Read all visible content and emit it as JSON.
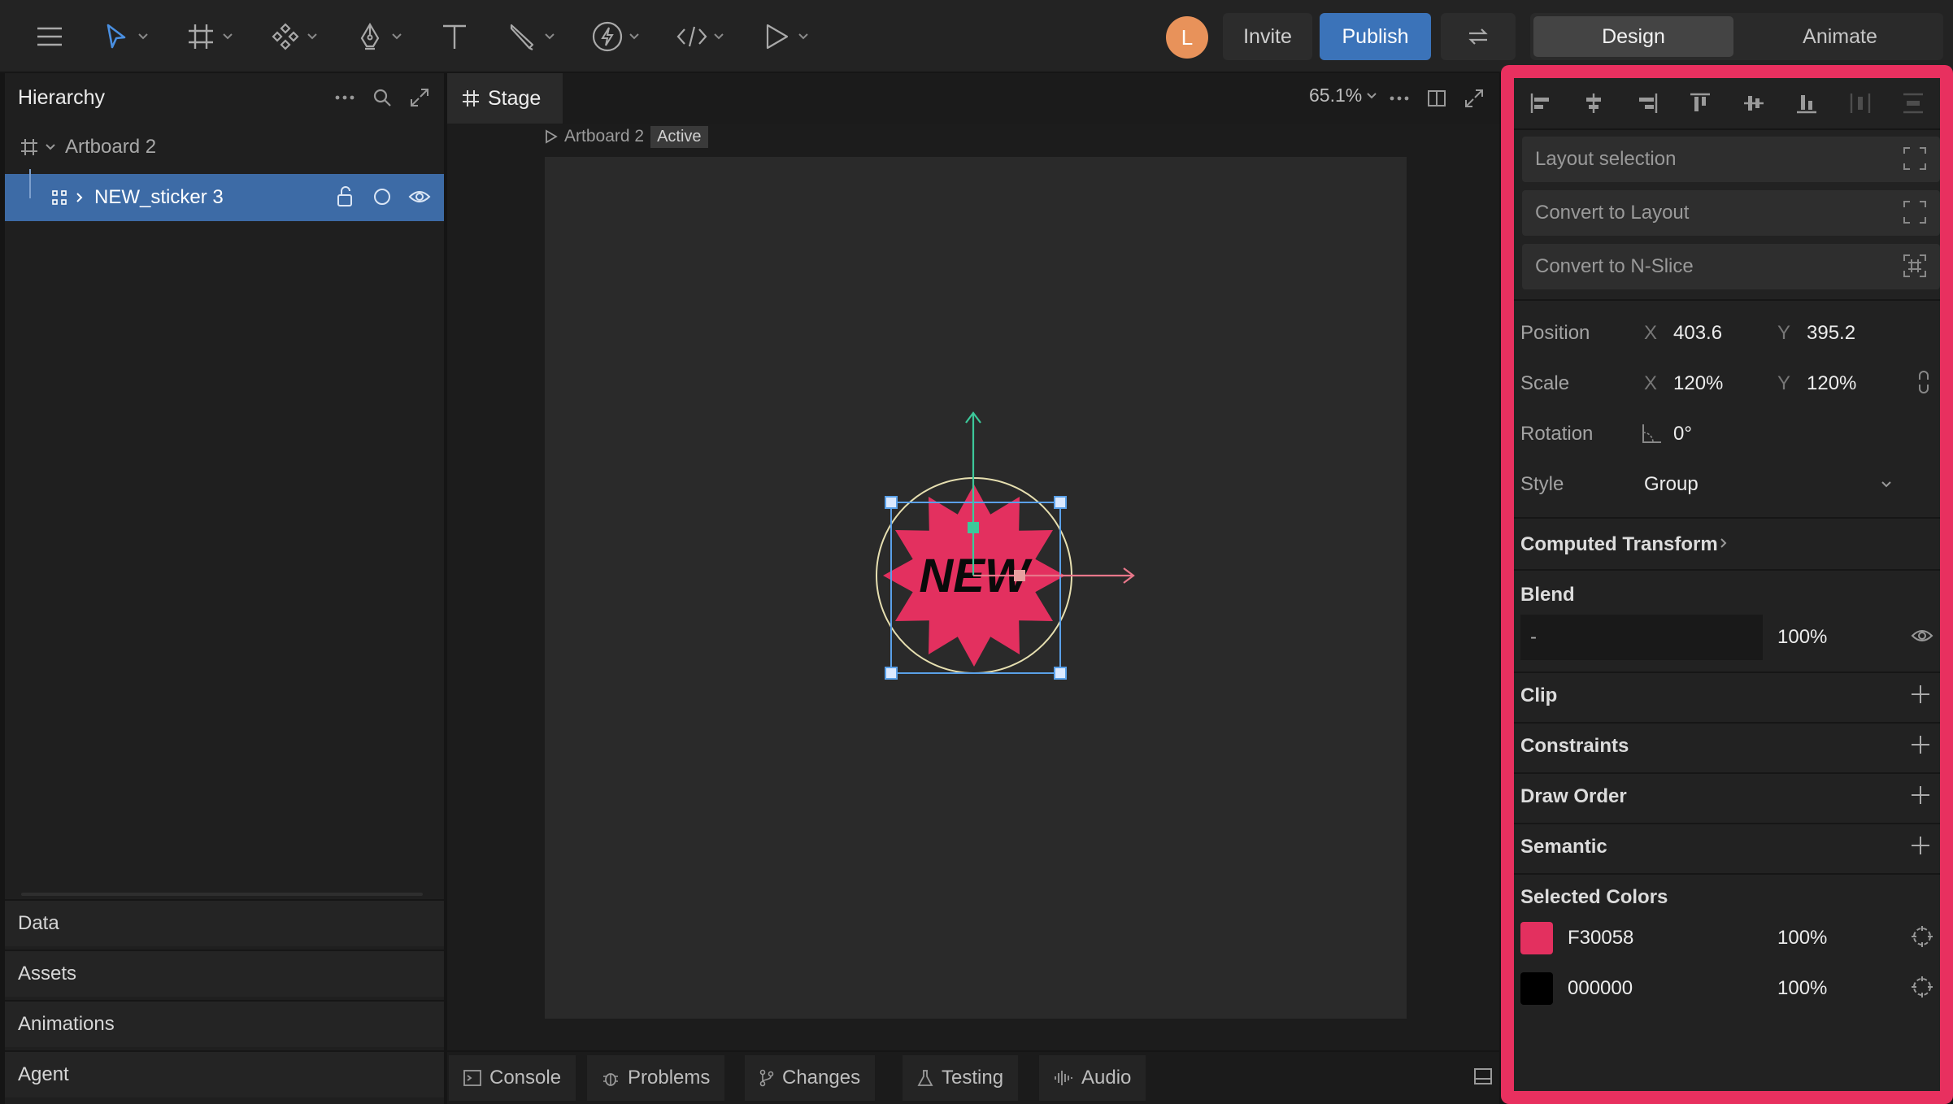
{
  "toolbar": {
    "avatar_initial": "L",
    "invite_label": "Invite",
    "publish_label": "Publish",
    "tabs": {
      "design": "Design",
      "animate": "Animate"
    }
  },
  "hierarchy": {
    "title": "Hierarchy",
    "items": [
      {
        "label": "Artboard 2"
      },
      {
        "label": "NEW_sticker 3"
      }
    ],
    "sections": [
      "Data",
      "Assets",
      "Animations",
      "Agent"
    ]
  },
  "stage": {
    "tab_label": "Stage",
    "zoom": "65.1%",
    "breadcrumb": "Artboard 2",
    "active_badge": "Active",
    "sticker_text": "NEW"
  },
  "bottom_tabs": [
    "Console",
    "Problems",
    "Changes",
    "Testing",
    "Audio"
  ],
  "design": {
    "layout_selection": "Layout selection",
    "convert_layout": "Convert to Layout",
    "convert_nslice": "Convert to N-Slice",
    "position": {
      "label": "Position",
      "x_axis": "X",
      "x": "403.6",
      "y_axis": "Y",
      "y": "395.2"
    },
    "scale": {
      "label": "Scale",
      "x_axis": "X",
      "x": "120%",
      "y_axis": "Y",
      "y": "120%"
    },
    "rotation": {
      "label": "Rotation",
      "value": "0°"
    },
    "style": {
      "label": "Style",
      "value": "Group"
    },
    "computed_transform": "Computed Transform",
    "blend": {
      "title": "Blend",
      "mode": "-",
      "opacity": "100%"
    },
    "clip": "Clip",
    "constraints": "Constraints",
    "draw_order": "Draw Order",
    "semantic": "Semantic",
    "selected_colors": {
      "title": "Selected Colors",
      "colors": [
        {
          "hex": "F30058",
          "swatch": "#e3305f",
          "opacity": "100%"
        },
        {
          "hex": "000000",
          "swatch": "#000000",
          "opacity": "100%"
        }
      ]
    }
  },
  "colors": {
    "accent_publish": "#3b73b9",
    "highlight_border": "#e8305f",
    "sticker_fill": "#e3305f"
  }
}
